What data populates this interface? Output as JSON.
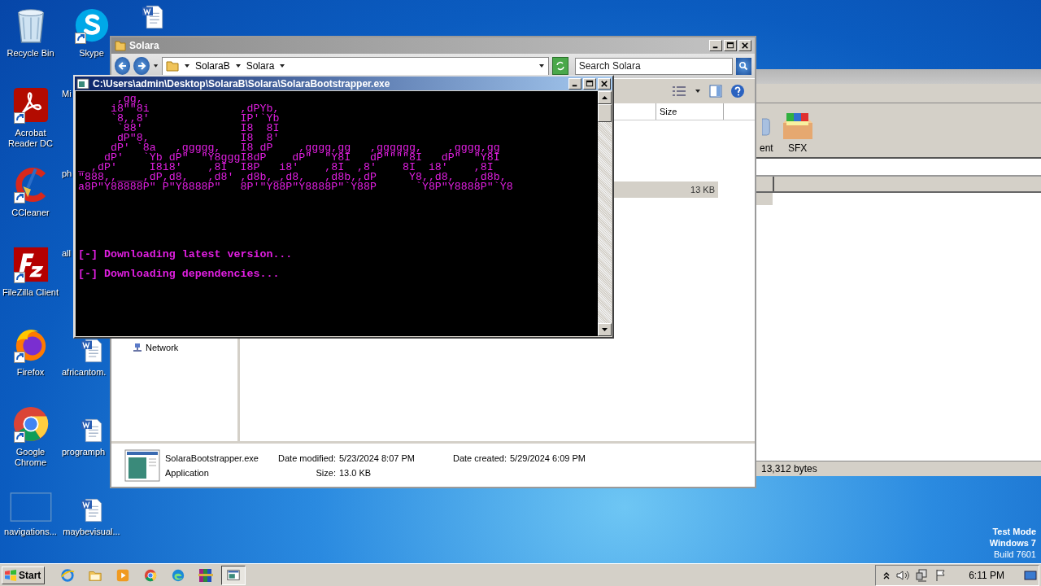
{
  "desktop": {
    "icons": [
      {
        "label": "Recycle Bin",
        "kind": "recycle",
        "shortcut": false
      },
      {
        "label": "Acrobat Reader DC",
        "kind": "pdf",
        "shortcut": true
      },
      {
        "label": "CCleaner",
        "kind": "ccleaner",
        "shortcut": true
      },
      {
        "label": "FileZilla Client",
        "kind": "filezilla",
        "shortcut": true
      },
      {
        "label": "Firefox",
        "kind": "firefox",
        "shortcut": true
      },
      {
        "label": "Google Chrome",
        "kind": "chrome",
        "shortcut": true
      },
      {
        "label": "navigations...",
        "kind": "blank",
        "shortcut": false
      },
      {
        "label": "Skype",
        "kind": "skype",
        "shortcut": true
      },
      {
        "label": "Mi",
        "cut": true
      },
      {
        "label": "ph",
        "cut": true
      },
      {
        "label": "all",
        "cut": true
      },
      {
        "label": "africantom.",
        "kind": "word",
        "shortcut": false,
        "cut": true
      },
      {
        "label": "programph",
        "kind": "word",
        "shortcut": false,
        "cut": true
      },
      {
        "label": "maybevisual...",
        "kind": "word",
        "shortcut": false
      },
      {
        "kind": "word",
        "shortcut": false
      }
    ],
    "os_notice": [
      "Test Mode",
      "Windows 7",
      "Build 7601"
    ]
  },
  "back_window": {
    "toolbar_items": [
      {
        "label": "ent",
        "kind": "app"
      },
      {
        "label": "SFX",
        "kind": "archive"
      }
    ],
    "status": "13,312 bytes"
  },
  "explorer": {
    "title": "Solara",
    "breadcrumb": [
      "SolaraB",
      "Solara"
    ],
    "search": {
      "placeholder": "Search Solara"
    },
    "columns": [
      "Size"
    ],
    "rows": [
      {
        "size": "13 KB",
        "selected": true
      }
    ],
    "nav_items": [
      "Network"
    ],
    "details": {
      "name": "SolaraBootstrapper.exe",
      "type": "Application",
      "modified_label": "Date modified:",
      "modified": "5/23/2024 8:07 PM",
      "size_label": "Size:",
      "size": "13.0 KB",
      "created_label": "Date created:",
      "created": "5/29/2024 6:09 PM"
    }
  },
  "console": {
    "title": "C:\\Users\\admin\\Desktop\\SolaraB\\Solara\\SolaraBootstrapper.exe",
    "banner": [
      "      ,gg,",
      "     i8\"\"8i              ,dPYb,",
      "     `8,,8'              IP'`Yb",
      "      `88'               I8  8I",
      "      dP\"8,              I8  8'",
      "     dP' `8a   ,ggggg,   I8 dP    ,gggg,gg   ,gggggg,    ,gggg,gg",
      "    dP'   `Yb dP\"  \"Y8gggI8dP    dP\"  \"Y8I   dP\"\"\"\"8I   dP\"  \"Y8I",
      "_ ,dP'     I8i8'    ,8I  I8P   i8'    ,8I  ,8'    8I  i8'    ,8I",
      "\"888,,____,dP,d8,   ,d8' ,d8b,_,d8,   ,d8b,,dP     Y8,,d8,   ,d8b,",
      "a8P\"Y88888P\" P\"Y8888P\"   8P'\"Y88P\"Y8888P\"`Y88P      `Y8P\"Y8888P\"`Y8"
    ],
    "lines": [
      "[-] Downloading latest version...",
      "[-] Downloading dependencies..."
    ]
  },
  "taskbar": {
    "start": "Start",
    "apps": [
      {
        "kind": "ie",
        "selected": false
      },
      {
        "kind": "folder",
        "selected": false
      },
      {
        "kind": "media",
        "selected": false
      },
      {
        "kind": "chrome",
        "selected": false
      },
      {
        "kind": "edge",
        "selected": false
      },
      {
        "kind": "winrar",
        "selected": false
      },
      {
        "kind": "console",
        "selected": true
      }
    ],
    "clock": "6:11 PM"
  }
}
